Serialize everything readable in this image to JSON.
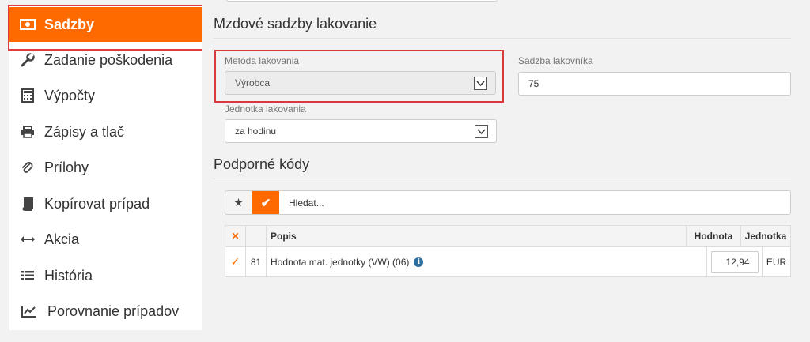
{
  "sidebar": {
    "items": [
      {
        "label": "Sadzby",
        "icon": "money-icon",
        "active": true
      },
      {
        "label": "Zadanie poškodenia",
        "icon": "wrench-icon"
      },
      {
        "label": "Výpočty",
        "icon": "calculator-icon"
      },
      {
        "label": "Zápisy a tlač",
        "icon": "printer-icon"
      },
      {
        "label": "Prílohy",
        "icon": "paperclip-icon"
      },
      {
        "label": "Kopírovat prípad",
        "icon": "book-icon"
      },
      {
        "label": "Akcia",
        "icon": "arrows-horizontal-icon"
      },
      {
        "label": "História",
        "icon": "list-icon"
      },
      {
        "label": "Porovnanie prípadov",
        "icon": "line-chart-icon"
      }
    ]
  },
  "main": {
    "rates_section_title": "Mzdové sadzby lakovanie",
    "method": {
      "label": "Metóda lakovania",
      "value": "Výrobca"
    },
    "painter_rate": {
      "label": "Sadzba lakovníka",
      "value": "75"
    },
    "unit": {
      "label": "Jednotka lakovania",
      "value": "za hodinu"
    },
    "support_section_title": "Podporné kódy",
    "search_placeholder": "Hledat...",
    "table": {
      "headers": {
        "select": "✕",
        "number": "",
        "description": "Popis",
        "value": "Hodnota",
        "unit": "Jednotka"
      },
      "rows": [
        {
          "checked": "✓",
          "number": "81",
          "description": "Hodnota mat. jednotky (VW) (06)",
          "value": "12,94",
          "unit": "EUR"
        }
      ]
    }
  },
  "colors": {
    "accent": "#ff6a00",
    "highlight_frame": "#d9393b",
    "info": "#2e6e9e"
  }
}
